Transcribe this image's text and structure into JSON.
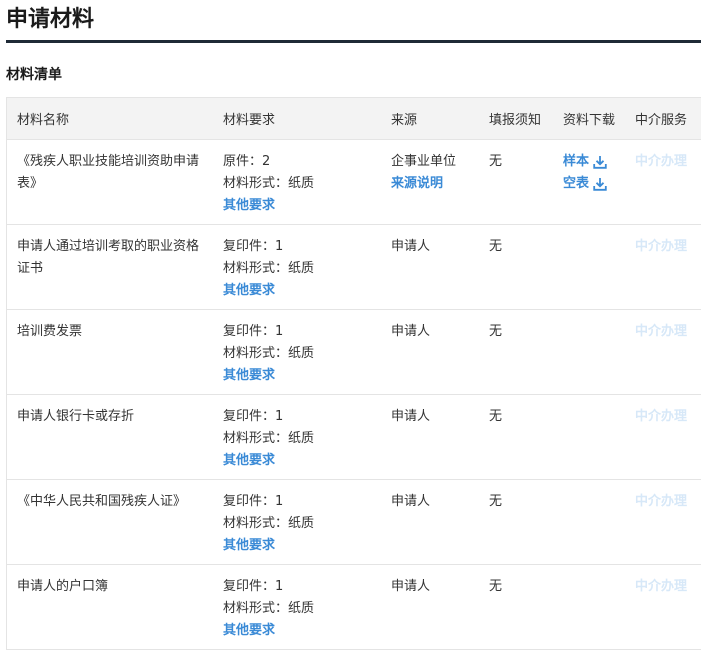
{
  "page_title": "申请材料",
  "section_title": "材料清单",
  "columns": [
    "材料名称",
    "材料要求",
    "来源",
    "填报须知",
    "资料下载",
    "中介服务"
  ],
  "rows": [
    {
      "name": "《残疾人职业技能培训资助申请表》",
      "req_count": "原件：2",
      "req_form": "材料形式：纸质",
      "req_link": "其他要求",
      "source": "企事业单位",
      "source_link": "来源说明",
      "notice": "无",
      "downloads": [
        {
          "label": "样本",
          "icon": "download-icon"
        },
        {
          "label": "空表",
          "icon": "download-icon"
        }
      ],
      "agent": "中介办理"
    },
    {
      "name": "申请人通过培训考取的职业资格证书",
      "req_count": "复印件：1",
      "req_form": "材料形式：纸质",
      "req_link": "其他要求",
      "source": "申请人",
      "notice": "无",
      "downloads": [],
      "agent": "中介办理"
    },
    {
      "name": "培训费发票",
      "req_count": "复印件：1",
      "req_form": "材料形式：纸质",
      "req_link": "其他要求",
      "source": "申请人",
      "notice": "无",
      "downloads": [],
      "agent": "中介办理"
    },
    {
      "name": "申请人银行卡或存折",
      "req_count": "复印件：1",
      "req_form": "材料形式：纸质",
      "req_link": "其他要求",
      "source": "申请人",
      "notice": "无",
      "downloads": [],
      "agent": "中介办理"
    },
    {
      "name": "《中华人民共和国残疾人证》",
      "req_count": "复印件：1",
      "req_form": "材料形式：纸质",
      "req_link": "其他要求",
      "source": "申请人",
      "notice": "无",
      "downloads": [],
      "agent": "中介办理"
    },
    {
      "name": "申请人的户口簿",
      "req_count": "复印件：1",
      "req_form": "材料形式：纸质",
      "req_link": "其他要求",
      "source": "申请人",
      "notice": "无",
      "downloads": [],
      "agent": "中介办理"
    }
  ],
  "colors": {
    "link": "#3a8ad6",
    "agent_disabled": "#d7e8f8",
    "header_bg": "#f3f3f3",
    "title_rule": "#1f2a36"
  }
}
